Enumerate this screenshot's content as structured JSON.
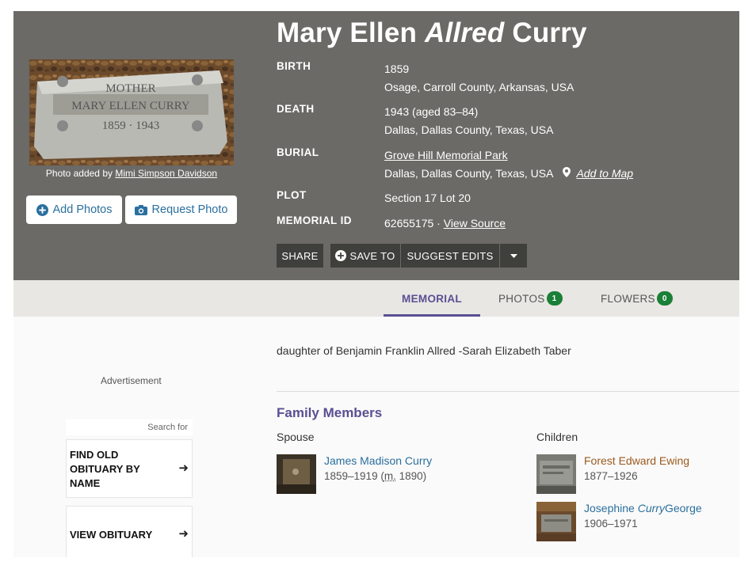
{
  "memorial": {
    "name_first": "Mary Ellen",
    "name_maiden": "Allred",
    "name_last": "Curry"
  },
  "photo": {
    "credit_prefix": "Photo added by",
    "credit_name": "Mimi Simpson Davidson",
    "headstone_line1": "MOTHER",
    "headstone_line2": "MARY ELLEN CURRY",
    "headstone_line3": "1859 · 1943"
  },
  "buttons": {
    "add_photos": "Add Photos",
    "request_photo": "Request Photo"
  },
  "facts": {
    "birth_label": "BIRTH",
    "birth_date": "1859",
    "birth_place": "Osage, Carroll County, Arkansas, USA",
    "death_label": "DEATH",
    "death_date": "1943 (aged 83–84)",
    "death_place": "Dallas, Dallas County, Texas, USA",
    "burial_label": "BURIAL",
    "burial_cemetery": "Grove Hill Memorial Park",
    "burial_place": "Dallas, Dallas County, Texas, USA",
    "add_to_map": "Add to Map",
    "plot_label": "PLOT",
    "plot_value": "Section 17 Lot 20",
    "memorial_id_label": "MEMORIAL ID",
    "memorial_id_value": "62655175 ·",
    "view_source": "View Source"
  },
  "actions": {
    "share": "SHARE",
    "save_to": "SAVE TO",
    "suggest_edits": "SUGGEST EDITS"
  },
  "tabs": [
    {
      "label": "MEMORIAL",
      "active": true
    },
    {
      "label": "PHOTOS",
      "badge": "1"
    },
    {
      "label": "FLOWERS",
      "badge": "0"
    }
  ],
  "sidebar": {
    "ad_label": "Advertisement",
    "search_for": "Search for",
    "ad1": "FIND OLD OBITUARY BY NAME",
    "ad1_l1": "FIND OLD",
    "ad1_l2": "OBITUARY BY",
    "ad1_l3": "NAME",
    "ad2": "VIEW OBITUARY"
  },
  "bio": "daughter of Benjamin Franklin Allred -Sarah Elizabeth Taber",
  "family": {
    "heading": "Family Members",
    "spouse_heading": "Spouse",
    "children_heading": "Children",
    "spouse": {
      "name": "James Madison Curry",
      "dates": "1859–1919",
      "marriage_abbr": "m.",
      "marriage_year": "1890)",
      "paren": "("
    },
    "children": [
      {
        "name": "Forest Edward Ewing",
        "dates": "1877–1926"
      },
      {
        "name_first": "Josephine",
        "name_maiden": "Curry",
        "name_last": "George",
        "dates": "1906–1971"
      }
    ]
  },
  "colors": {
    "hero_bg": "#6b6a66",
    "accent_purple": "#5a4f93",
    "link_blue": "#2a6f9e",
    "badge_green": "#1a7f37",
    "tab_bar_bg": "#e8e7e3"
  }
}
